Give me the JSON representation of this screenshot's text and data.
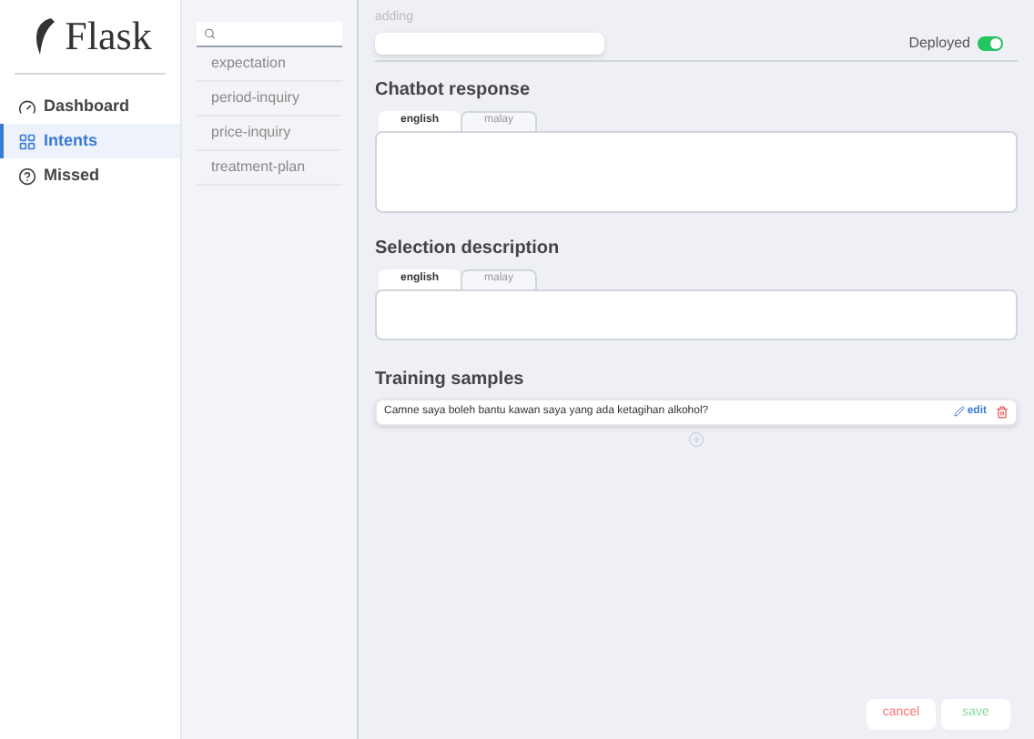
{
  "logo": {
    "text": "Flask"
  },
  "sidebar": {
    "items": [
      {
        "label": "Dashboard",
        "selected": false
      },
      {
        "label": "Intents",
        "selected": true
      },
      {
        "label": "Missed",
        "selected": false
      }
    ]
  },
  "intent_list": {
    "items": [
      {
        "label": "expectation"
      },
      {
        "label": "period-inquiry"
      },
      {
        "label": "price-inquiry"
      },
      {
        "label": "treatment-plan"
      }
    ]
  },
  "editor": {
    "name_field": {
      "label": "adding"
    },
    "deployed": {
      "label": "Deployed",
      "on": true
    },
    "sections": [
      {
        "title": "Chatbot response",
        "tabs": [
          {
            "label": "english",
            "selected": true
          },
          {
            "label": "malay",
            "selected": false
          }
        ]
      },
      {
        "title": "Selection description",
        "tabs": [
          {
            "label": "english",
            "selected": true
          },
          {
            "label": "malay",
            "selected": false
          }
        ]
      }
    ],
    "training": {
      "title": "Training samples",
      "samples": [
        {
          "text": "Camne saya boleh bantu kawan saya yang ada ketagihan alkohol?",
          "edit": "edit"
        }
      ]
    },
    "buttons": {
      "cancel": "cancel",
      "save": "save"
    }
  }
}
